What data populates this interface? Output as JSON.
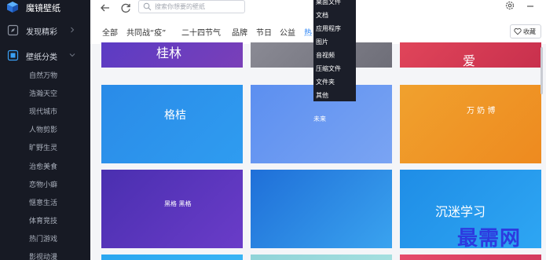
{
  "app": {
    "name": "魔镜壁纸"
  },
  "sidebar": {
    "nav": [
      {
        "label": "发现精彩",
        "icon": "compass-icon"
      },
      {
        "label": "壁纸分类",
        "icon": "category-icon"
      }
    ],
    "subitems": [
      "自然万物",
      "浩瀚天空",
      "现代城市",
      "人物剪影",
      "旷野生灵",
      "治愈美食",
      "恋物小癖",
      "惬意生活",
      "体育竞技",
      "热门游戏",
      "影视动漫"
    ]
  },
  "toolbar": {
    "search_placeholder": "搜索你想要的壁纸"
  },
  "tabs": [
    "全部",
    "共同战“疫”",
    "二十四节气",
    "品牌",
    "节日",
    "公益",
    "热"
  ],
  "favorite": {
    "label": "收藏"
  },
  "dropdown": {
    "items": [
      "桌面文件",
      "文档",
      "应用程序",
      "图片",
      "音视频",
      "压缩文件",
      "文件夹",
      "其他"
    ]
  },
  "cards": [
    {
      "text": "桂林",
      "colors": [
        "#5b3cc4",
        "#7a3fb8"
      ]
    },
    {
      "text": "",
      "colors": [
        "#8a8a94",
        "#6e6e78"
      ]
    },
    {
      "text": "爱",
      "colors": [
        "#e0455a",
        "#c8304d"
      ]
    },
    {
      "text": "格桔",
      "colors": [
        "#2a8be8",
        "#2f9cf0"
      ]
    },
    {
      "text": "未来",
      "colors": [
        "#5c8ff0",
        "#7aa4f3"
      ]
    },
    {
      "text": "万 奶 博",
      "colors": [
        "#f0a12e",
        "#ee8a1f"
      ]
    },
    {
      "text": "黑格 黑格",
      "colors": [
        "#4a2fb0",
        "#6a3cc8"
      ]
    },
    {
      "text": "",
      "colors": [
        "#1f6fd8",
        "#3aa3ef"
      ]
    },
    {
      "text": "沉迷学习",
      "colors": [
        "#1f8de6",
        "#2ea6f3"
      ]
    }
  ],
  "watermark": "最需网"
}
